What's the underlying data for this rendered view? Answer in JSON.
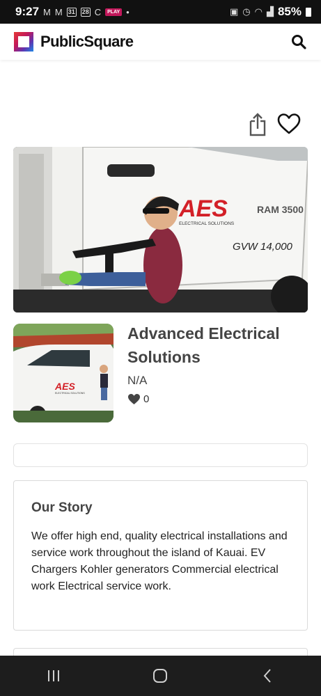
{
  "status_bar": {
    "time": "9:27",
    "calendar_day_1": "31",
    "calendar_day_2": "28",
    "play_label": "PLAY",
    "battery": "85%"
  },
  "header": {
    "app_name": "PublicSquare"
  },
  "business": {
    "name": "Advanced Electrical Solutions",
    "subtitle": "N/A",
    "likes": "0",
    "hero_image": {
      "truck_logo": "AES",
      "truck_logo_sub": "ELECTRICAL SOLUTIONS",
      "truck_badge": "RAM 3500",
      "truck_gvw": "GVW 14,000"
    },
    "thumb_image": {
      "truck_logo": "AES",
      "truck_logo_sub": "ELECTRICAL SOLUTIONS"
    }
  },
  "story": {
    "title": "Our Story",
    "text": "We offer high end, quality electrical installations and service work throughout the island of Kauai. EV Chargers Kohler generators Commercial electrical work Electrical service work."
  },
  "colors": {
    "status_bar": "#111111",
    "nav_bar": "#1d1d1d",
    "brand_red": "#e53935",
    "brand_blue": "#1e88e5",
    "truck_logo_red": "#d32027"
  }
}
